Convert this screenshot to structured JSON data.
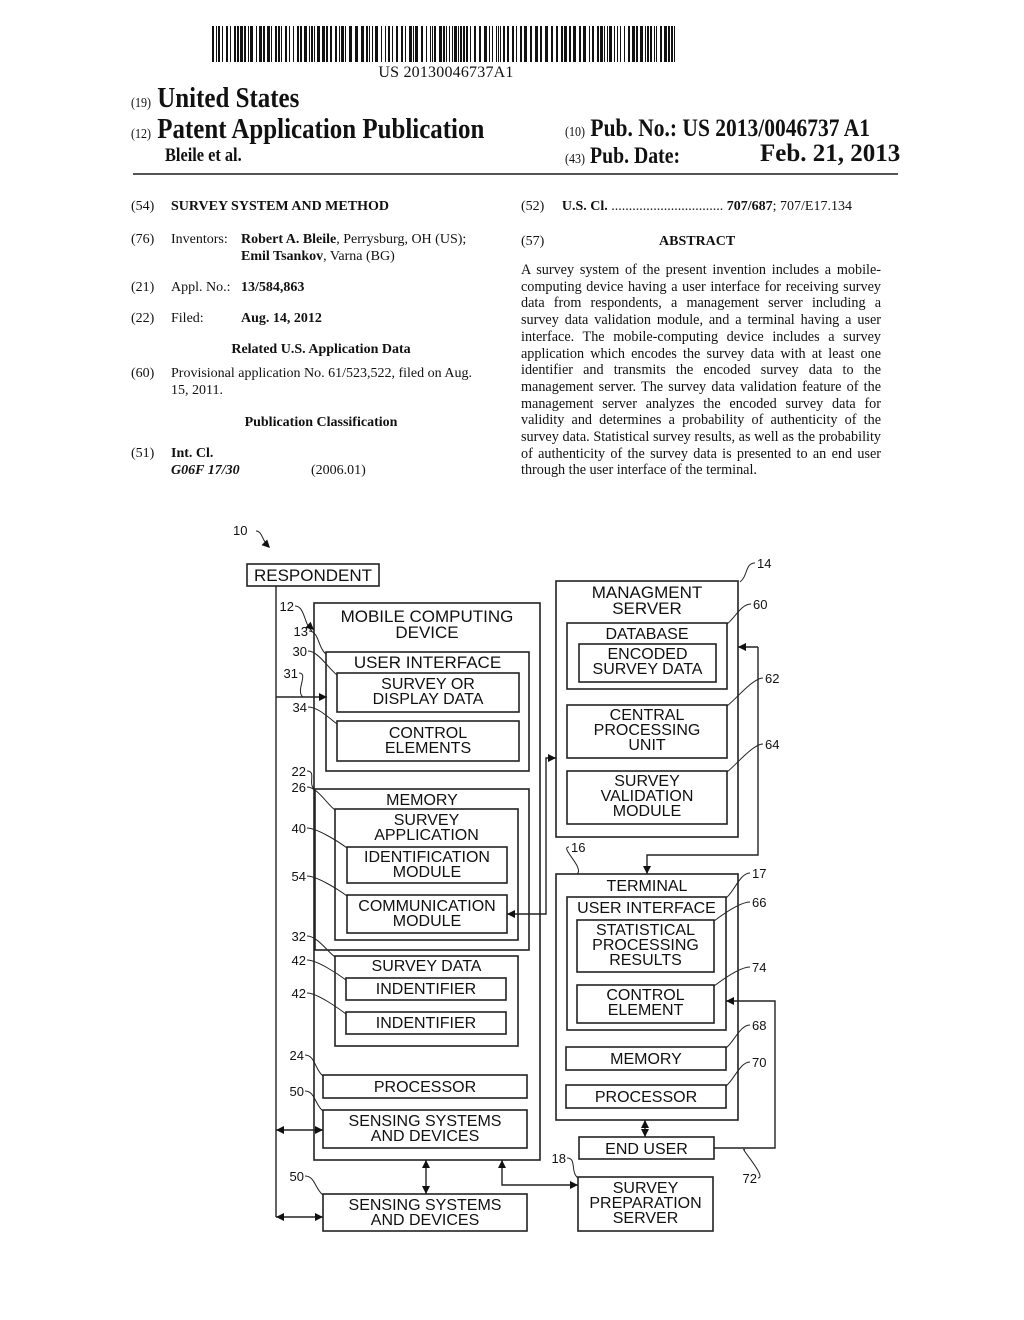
{
  "header": {
    "barcode_text": "US 20130046737A1",
    "country_num": "(19)",
    "country": "United States",
    "pubtype_num": "(12)",
    "pubtype": "Patent Application Publication",
    "authors": "Bleile et al.",
    "pubno_num": "(10)",
    "pubno_label": "Pub. No.:",
    "pubno_value": "US 2013/0046737 A1",
    "pubdate_num": "(43)",
    "pubdate_label": "Pub. Date:",
    "pubdate_value": "Feb. 21, 2013"
  },
  "left_column": {
    "title_num": "(54)",
    "title": "SURVEY SYSTEM AND METHOD",
    "inventors_num": "(76)",
    "inventors_label": "Inventors:",
    "inventor1_name": "Robert A. Bleile",
    "inventor1_loc": ", Perrysburg, OH (US);",
    "inventor2_name": "Emil Tsankov",
    "inventor2_loc": ", Varna (BG)",
    "appl_num": "(21)",
    "appl_label": "Appl. No.:",
    "appl_value": "13/584,863",
    "filed_num": "(22)",
    "filed_label": "Filed:",
    "filed_value": "Aug. 14, 2012",
    "related_heading": "Related U.S. Application Data",
    "provisional_num": "(60)",
    "provisional_line1": "Provisional application No. 61/523,522, filed on Aug.",
    "provisional_line2": "15, 2011.",
    "pubclass_heading": "Publication Classification",
    "intcl_num": "(51)",
    "intcl_label": "Int. Cl.",
    "intcl_code": "G06F 17/30",
    "intcl_version": "(2006.01)"
  },
  "right_column": {
    "uscl_num": "(52)",
    "uscl_label": "U.S. Cl.",
    "uscl_dots": "................................",
    "uscl_primary": "707/687",
    "uscl_secondary": "; 707/E17.134",
    "abstract_num": "(57)",
    "abstract_heading": "ABSTRACT",
    "abstract_text": "A survey system of the present invention includes a mobile-computing device having a user interface for receiving survey data from respondents, a management server including a survey data validation module, and a terminal having a user interface. The mobile-computing device includes a survey application which encodes the survey data with at least one identifier and transmits the encoded survey data to the management server. The survey data validation feature of the management server analyzes the encoded survey data for validity and determines a probability of authenticity of the survey data. Statistical survey results, as well as the probability of authenticity of the survey data is presented to an end user through the user interface of the terminal."
  },
  "figure": {
    "system_ref": "10",
    "boxes": {
      "respondent": [
        "RESPONDENT"
      ],
      "mobile": [
        "MOBILE COMPUTING",
        "DEVICE"
      ],
      "mobile_ui": [
        "USER INTERFACE"
      ],
      "survey_display": [
        "SURVEY OR",
        "DISPLAY DATA"
      ],
      "control_elements": [
        "CONTROL",
        "ELEMENTS"
      ],
      "memory": [
        "MEMORY"
      ],
      "survey_app": [
        "SURVEY",
        "APPLICATION"
      ],
      "ident_module": [
        "IDENTIFICATION",
        "MODULE"
      ],
      "comm_module": [
        "COMMUNICATION",
        "MODULE"
      ],
      "survey_data": [
        "SURVEY DATA"
      ],
      "identifier1": [
        "INDENTIFIER"
      ],
      "identifier2": [
        "INDENTIFIER"
      ],
      "processor": [
        "PROCESSOR"
      ],
      "sensing_inner": [
        "SENSING SYSTEMS",
        "AND DEVICES"
      ],
      "sensing_outer": [
        "SENSING SYSTEMS",
        "AND DEVICES"
      ],
      "mgmt_server": [
        "MANAGMENT",
        "SERVER"
      ],
      "database": [
        "DATABASE"
      ],
      "encoded_data": [
        "ENCODED",
        "SURVEY DATA"
      ],
      "cpu": [
        "CENTRAL",
        "PROCESSING",
        "UNIT"
      ],
      "validation": [
        "SURVEY",
        "VALIDATION",
        "MODULE"
      ],
      "terminal": [
        "TERMINAL"
      ],
      "terminal_ui": [
        "USER INTERFACE"
      ],
      "stat_results": [
        "STATISTICAL",
        "PROCESSING",
        "RESULTS"
      ],
      "control_element": [
        "CONTROL",
        "ELEMENT"
      ],
      "terminal_memory": [
        "MEMORY"
      ],
      "terminal_processor": [
        "PROCESSOR"
      ],
      "end_user": [
        "END USER"
      ],
      "survey_prep": [
        "SURVEY",
        "PREPARATION",
        "SERVER"
      ]
    },
    "refs": {
      "mobile": "12",
      "mobile_ui": "13",
      "survey_display": "30",
      "arrow31": "31",
      "control_elements": "34",
      "memory": "22",
      "survey_app": "26",
      "ident_module": "40",
      "comm_module": "54",
      "survey_data": "32",
      "identifier1": "42",
      "identifier2": "42",
      "processor": "24",
      "sensing_inner": "50",
      "sensing_outer": "50",
      "mgmt_server": "14",
      "database": "60",
      "cpu": "62",
      "validation": "64",
      "terminal": "16",
      "terminal_ui": "17",
      "stat_results": "66",
      "control_element": "74",
      "terminal_memory": "68",
      "terminal_processor": "70",
      "loop72": "72",
      "survey_prep": "18"
    }
  }
}
